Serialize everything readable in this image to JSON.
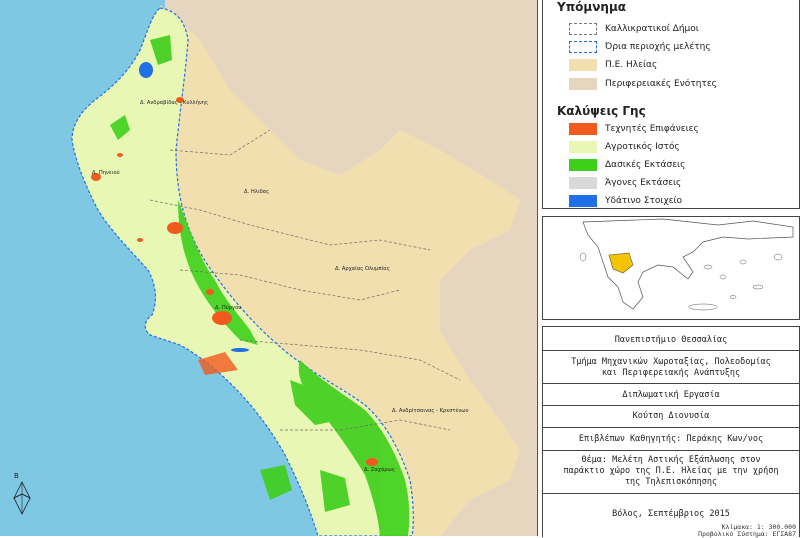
{
  "legend": {
    "title": "Υπόμνημα",
    "items": [
      {
        "label": "Καλλικρατικοί Δήμοι",
        "style": "dashed-gray"
      },
      {
        "label": "Όρια περιοχής μελέτης",
        "style": "dashed-blue"
      },
      {
        "label": "Π.Ε. Ηλείας",
        "color": "#f2dfb0"
      },
      {
        "label": "Περιφερειακές Ενότητες",
        "color": "#e6d6c0"
      }
    ],
    "landcover_title": "Καλύψεις Γης",
    "landcover": [
      {
        "label": "Τεχνητές Επιφάνειες",
        "color": "#f05a1e"
      },
      {
        "label": "Αγροτικός Ιστός",
        "color": "#e8f7b4"
      },
      {
        "label": "Δασικές Εκτάσεις",
        "color": "#3ecf1a"
      },
      {
        "label": "Άγονες Εκτάσεις",
        "color": "#d9d9d9"
      },
      {
        "label": "Υδάτινο Στοιχείο",
        "color": "#1f6fe8"
      }
    ]
  },
  "map": {
    "places": [
      "Δ. Ανδραβίδας - Κυλλήνης",
      "Δ. Πηνειού",
      "Δ. Ηλιδας",
      "Δ. Αρχαίας Ολυμπίας",
      "Δ. Πύργου",
      "Δ. Ανδρίτσαινας - Κρεστένων",
      "Δ. Ζαχάρως"
    ],
    "north_label": "Β",
    "colors": {
      "sea": "#7ec8e3",
      "elis": "#f2dfb0",
      "other_regions": "#e6d6c0",
      "agri": "#e8f7b4",
      "forest": "#3ecf1a",
      "urban": "#f05a1e",
      "water": "#1f6fe8"
    }
  },
  "title_block": {
    "university": "Πανεπιστήμιο Θεσσαλίας",
    "department_1": "Τμήμα Μηχανικών Χωροταξίας, Πολεοδομίας",
    "department_2": "και Περιφερειακής Ανάπτυξης",
    "thesis": "Διπλωματική Εργασία",
    "author": "Κούτση Διονυσία",
    "supervisor": "Επιβλέπων Καθηγητής: Περάκης Κων/νος",
    "topic_1": "Θέμα: Μελέτη Αστικής Εξάπλωσης στον",
    "topic_2": "παράκτιο χώρο της Π.Ε. Ηλείας με την χρήση",
    "topic_3": "της Τηλεπισκόπησης",
    "date": "Βόλος, Σεπτέμβριος 2015",
    "scale": "Κλίμακα: 1: 300.000",
    "projection": "Προβολικό Σύστημα: ΕΓΣΑ87"
  }
}
